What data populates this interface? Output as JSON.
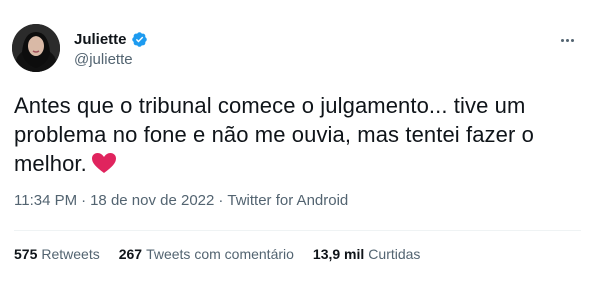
{
  "author": {
    "display_name": "Juliette",
    "handle": "@juliette",
    "verified_icon": "verified-badge-icon",
    "verified_color": "#1d9bf0"
  },
  "tweet": {
    "text": "Antes que o tribunal comece o julgamento... tive um problema no fone e não me ouvia, mas tentei fazer o melhor.",
    "emoji_icon": "red-heart-icon",
    "emoji_color": "#e0245e"
  },
  "meta": {
    "time": "11:34 PM",
    "separator": "·",
    "date": "18 de nov de 2022",
    "source": "Twitter for Android"
  },
  "stats": {
    "retweets_count": "575",
    "retweets_label": "Retweets",
    "quotes_count": "267",
    "quotes_label": "Tweets com comentário",
    "likes_count": "13,9 mil",
    "likes_label": "Curtidas"
  },
  "more_icon": "more-horizontal-icon"
}
